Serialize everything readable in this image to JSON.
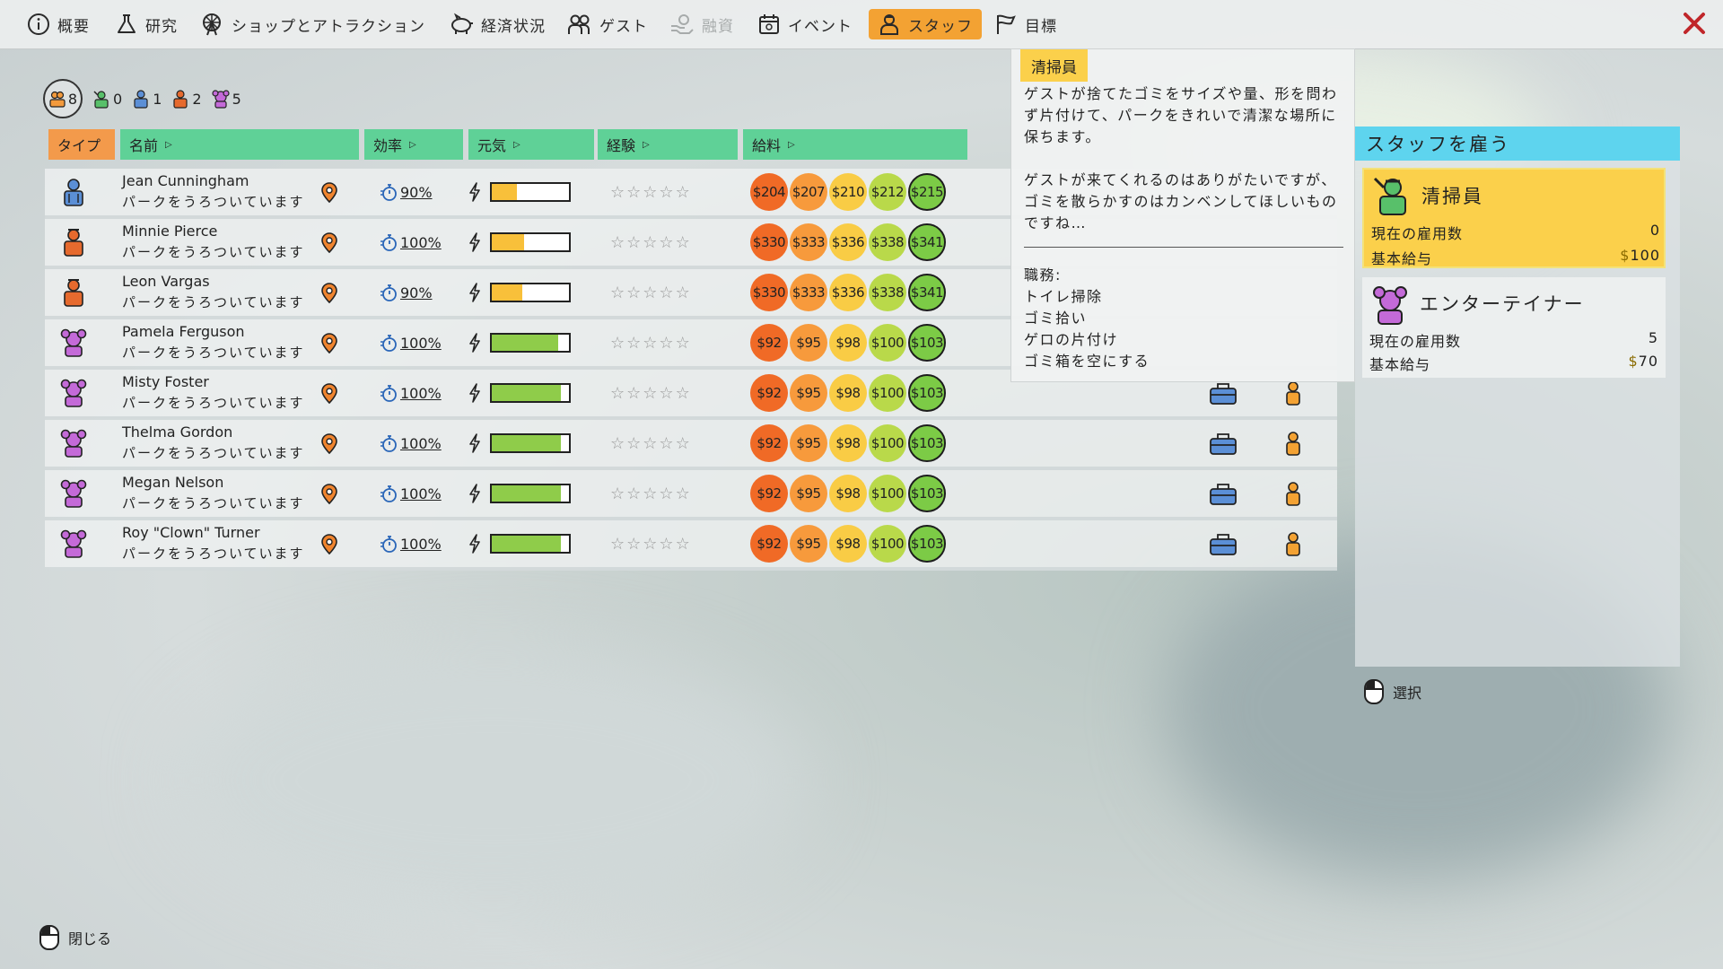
{
  "nav": {
    "items": [
      {
        "label": "概要"
      },
      {
        "label": "研究"
      },
      {
        "label": "ショップとアトラクション"
      },
      {
        "label": "経済状況"
      },
      {
        "label": "ゲスト"
      },
      {
        "label": "融資"
      },
      {
        "label": "イベント"
      },
      {
        "label": "スタッフ"
      },
      {
        "label": "目標"
      }
    ]
  },
  "badges": {
    "all": "8",
    "janitor": "0",
    "mechanic": "1",
    "security": "2",
    "entertainer": "5"
  },
  "table": {
    "headers": {
      "type": "タイプ",
      "name": "名前",
      "efficiency": "効率",
      "energy": "元気",
      "experience": "経験",
      "salary": "給料"
    },
    "rows": [
      {
        "name": "Jean Cunningham",
        "status": "パークをうろついています",
        "efficiency": "90%",
        "energy": 0.32,
        "energy_color": "#f8c03a",
        "salary": [
          "$204",
          "$207",
          "$210",
          "$212",
          "$215"
        ],
        "type": "mechanic"
      },
      {
        "name": "Minnie Pierce",
        "status": "パークをうろついています",
        "efficiency": "100%",
        "energy": 0.42,
        "energy_color": "#f8c03a",
        "salary": [
          "$330",
          "$333",
          "$336",
          "$338",
          "$341"
        ],
        "type": "security"
      },
      {
        "name": "Leon Vargas",
        "status": "パークをうろついています",
        "efficiency": "90%",
        "energy": 0.4,
        "energy_color": "#f8c03a",
        "salary": [
          "$330",
          "$333",
          "$336",
          "$338",
          "$341"
        ],
        "type": "security"
      },
      {
        "name": "Pamela Ferguson",
        "status": "パークをうろついています",
        "efficiency": "100%",
        "energy": 0.86,
        "energy_color": "#8fcc4a",
        "salary": [
          "$92",
          "$95",
          "$98",
          "$100",
          "$103"
        ],
        "type": "entertainer"
      },
      {
        "name": "Misty Foster",
        "status": "パークをうろついています",
        "efficiency": "100%",
        "energy": 0.9,
        "energy_color": "#8fcc4a",
        "salary": [
          "$92",
          "$95",
          "$98",
          "$100",
          "$103"
        ],
        "type": "entertainer"
      },
      {
        "name": "Thelma Gordon",
        "status": "パークをうろついています",
        "efficiency": "100%",
        "energy": 0.9,
        "energy_color": "#8fcc4a",
        "salary": [
          "$92",
          "$95",
          "$98",
          "$100",
          "$103"
        ],
        "type": "entertainer"
      },
      {
        "name": "Megan Nelson",
        "status": "パークをうろついています",
        "efficiency": "100%",
        "energy": 0.9,
        "energy_color": "#8fcc4a",
        "salary": [
          "$92",
          "$95",
          "$98",
          "$100",
          "$103"
        ],
        "type": "entertainer"
      },
      {
        "name": "Roy \"Clown\" Turner",
        "status": "パークをうろついています",
        "efficiency": "100%",
        "energy": 0.9,
        "energy_color": "#8fcc4a",
        "salary": [
          "$92",
          "$95",
          "$98",
          "$100",
          "$103"
        ],
        "type": "entertainer"
      }
    ],
    "coin_colors": [
      "#f06a26",
      "#f79a3c",
      "#f9cc45",
      "#b9d94a",
      "#7ccb46"
    ]
  },
  "tooltip": {
    "title": "清掃員",
    "desc1": "ゲストが捨てたゴミをサイズや量、形を問わず片付けて、パークをきれいで清潔な場所に保ちます。",
    "desc2": "ゲストが来てくれるのはありがたいですが、ゴミを散らかすのはカンベンしてほしいものですね…",
    "duties_label": "職務:",
    "duties": [
      "トイレ掃除",
      "ゴミ拾い",
      "ゲロの片付け",
      "ゴミ箱を空にする"
    ]
  },
  "hire": {
    "title": "スタッフを雇う",
    "cards": [
      {
        "name": "清掃員",
        "count_label": "現在の雇用数",
        "count": "0",
        "salary_label": "基本給与",
        "salary": "100"
      },
      {
        "name": "エンターテイナー",
        "count_label": "現在の雇用数",
        "count": "5",
        "salary_label": "基本給与",
        "salary": "70"
      }
    ]
  },
  "hints": {
    "select": "選択",
    "close": "閉じる"
  }
}
